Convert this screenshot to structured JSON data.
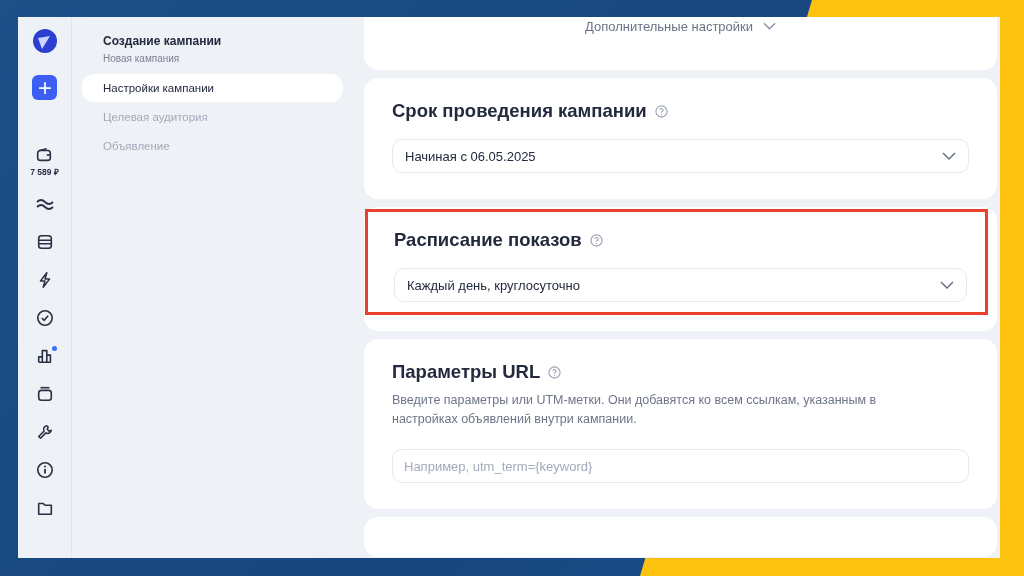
{
  "rail": {
    "balance": "7 589 ₽",
    "items": [
      {
        "badge": false
      },
      {
        "badge": false
      },
      {
        "badge": false
      },
      {
        "badge": false
      },
      {
        "badge": true
      },
      {
        "badge": false
      },
      {
        "badge": false
      },
      {
        "badge": false
      },
      {
        "badge": false
      }
    ]
  },
  "nav": {
    "title": "Создание кампании",
    "subtitle": "Новая кампания",
    "steps": [
      {
        "label": "Настройки кампании",
        "selected": true
      },
      {
        "label": "Целевая аудитория",
        "selected": false
      },
      {
        "label": "Объявление",
        "selected": false
      }
    ]
  },
  "sections": [
    {
      "kind": "toggle",
      "label": "Дополнительные настройки"
    },
    {
      "kind": "select",
      "title": "Срок проведения кампании",
      "value": "Начиная с 06.05.2025",
      "highlighted": false
    },
    {
      "kind": "select",
      "title": "Расписание показов",
      "value": "Каждый день, круглосуточно",
      "highlighted": true
    },
    {
      "kind": "input",
      "title": "Параметры URL",
      "description": "Введите параметры или UTM-метки. Они добавятся ко всем ссылкам, указанным в настройках объявлений внутри кампании.",
      "placeholder": "Например, utm_term={keyword}",
      "highlighted": false
    },
    {
      "kind": "blank"
    }
  ]
}
